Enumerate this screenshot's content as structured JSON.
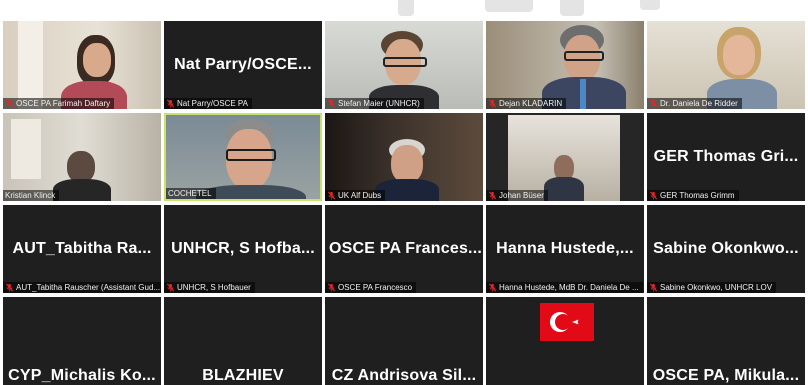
{
  "participants": [
    {
      "label": "OSCE PA Farimah Daftary",
      "big_name": "",
      "mic": "muted",
      "video": "on"
    },
    {
      "label": "Nat Parry/OSCE PA",
      "big_name": "Nat Parry/OSCE...",
      "mic": "muted",
      "video": "off"
    },
    {
      "label": "Stefan Maier (UNHCR)",
      "big_name": "",
      "mic": "muted",
      "video": "on"
    },
    {
      "label": "Dejan KLADARIN",
      "big_name": "",
      "mic": "muted",
      "video": "on"
    },
    {
      "label": "Dr. Daniela De Ridder",
      "big_name": "",
      "mic": "muted",
      "video": "on"
    },
    {
      "label": "Kristian Klinck",
      "big_name": "",
      "mic": "none",
      "video": "on"
    },
    {
      "label": "COCHETEL",
      "big_name": "",
      "mic": "none",
      "video": "on",
      "active_speaker": true
    },
    {
      "label": "UK Alf Dubs",
      "big_name": "",
      "mic": "muted",
      "video": "on"
    },
    {
      "label": "Johan Büser",
      "big_name": "",
      "mic": "muted",
      "video": "on"
    },
    {
      "label": "GER Thomas Grimm",
      "big_name": "GER Thomas Gri...",
      "mic": "muted",
      "video": "off"
    },
    {
      "label": "AUT_Tabitha Rauscher (Assistant Gud...",
      "big_name": "AUT_Tabitha Ra...",
      "mic": "muted",
      "video": "off"
    },
    {
      "label": "UNHCR, S Hofbauer",
      "big_name": "UNHCR, S Hofba...",
      "mic": "muted",
      "video": "off"
    },
    {
      "label": "OSCE PA Francesco",
      "big_name": "OSCE PA Frances...",
      "mic": "muted",
      "video": "off"
    },
    {
      "label": "Hanna Hustede, MdB Dr. Daniela De ...",
      "big_name": "Hanna Hustede,...",
      "mic": "muted",
      "video": "off"
    },
    {
      "label": "Sabine Okonkwo, UNHCR LOV",
      "big_name": "Sabine Okonkwo...",
      "mic": "muted",
      "video": "off"
    },
    {
      "label": "",
      "big_name": "CYP_Michalis Ko...",
      "mic": "none",
      "video": "off"
    },
    {
      "label": "",
      "big_name": "BLAZHIEV",
      "mic": "none",
      "video": "off"
    },
    {
      "label": "",
      "big_name": "CZ Andrisova Sil...",
      "mic": "none",
      "video": "off"
    },
    {
      "label": "",
      "big_name": "",
      "mic": "none",
      "video": "on",
      "flag": "turkey"
    },
    {
      "label": "",
      "big_name": "OSCE PA, Mikula...",
      "mic": "none",
      "video": "off"
    }
  ],
  "colors": {
    "tile_bg": "#1f1f1f",
    "active_border": "#c8e36a",
    "mic_muted": "#e02828",
    "page_bg": "#ffffff"
  }
}
